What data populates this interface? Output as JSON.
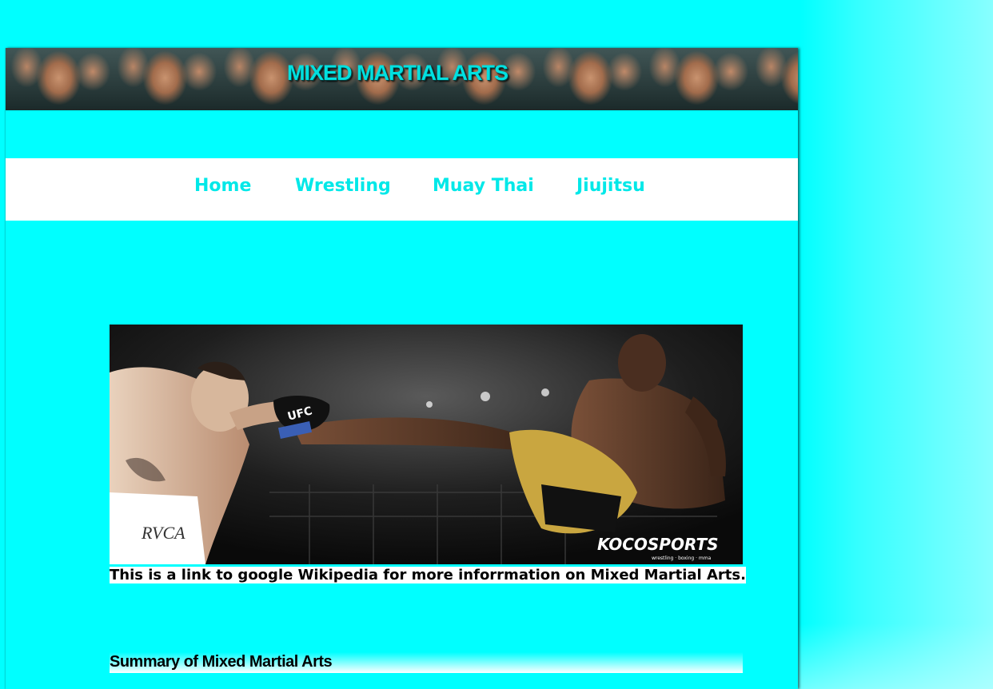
{
  "banner": {
    "title": "MIXED MARTIAL ARTS"
  },
  "nav": {
    "items": [
      {
        "label": "Home"
      },
      {
        "label": "Wrestling"
      },
      {
        "label": "Muay Thai"
      },
      {
        "label": "Jiujitsu"
      }
    ]
  },
  "hero": {
    "glove_text": "UFC",
    "watermark": "KOCOSPORTS",
    "watermark_tagline": "wrestling · boxing · mma",
    "shorts_brand": "RVCA"
  },
  "content": {
    "link_text": "This is a link to google Wikipedia for more inforrmation on Mixed Martial Arts.",
    "summary_heading": "Summary of Mixed Martial Arts"
  },
  "colors": {
    "page_background": "#00ffff",
    "nav_background": "#ffffff",
    "nav_text": "#00e8e8",
    "banner_title": "#00e0e0"
  }
}
